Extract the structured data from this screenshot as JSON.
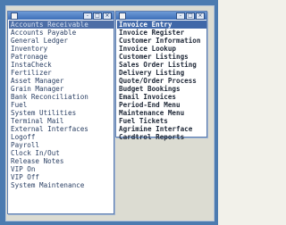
{
  "left_window": {
    "items": [
      {
        "label": "Accounts Receivable",
        "selected": true
      },
      {
        "label": "Accounts Payable"
      },
      {
        "label": "General Ledger"
      },
      {
        "label": "Inventory"
      },
      {
        "label": "Patronage"
      },
      {
        "label": "InstaCheck"
      },
      {
        "label": "Fertilizer"
      },
      {
        "label": "Asset Manager"
      },
      {
        "label": "Grain Manager"
      },
      {
        "label": "Bank Reconciliation"
      },
      {
        "label": "Fuel"
      },
      {
        "label": "System Utilities"
      },
      {
        "label": "Terminal Mail"
      },
      {
        "label": "External Interfaces"
      },
      {
        "label": "Logoff"
      },
      {
        "label": "Payroll"
      },
      {
        "label": "Clock In/Out"
      },
      {
        "label": "Release Notes"
      },
      {
        "label": "VIP On"
      },
      {
        "label": "VIP Off"
      },
      {
        "label": "System Maintenance"
      }
    ]
  },
  "right_window": {
    "items": [
      {
        "label": "Invoice Entry",
        "selected": true
      },
      {
        "label": "Invoice Register"
      },
      {
        "label": "Customer Information"
      },
      {
        "label": "Invoice Lookup"
      },
      {
        "label": "Customer Listings"
      },
      {
        "label": "Sales Order Listing"
      },
      {
        "label": "Delivery Listing"
      },
      {
        "label": "Quote/Order Process"
      },
      {
        "label": "Budget Bookings"
      },
      {
        "label": "Email Invoices"
      },
      {
        "label": "Period-End Menu"
      },
      {
        "label": "Maintenance Menu"
      },
      {
        "label": "Fuel Tickets"
      },
      {
        "label": "Agrimine Interface"
      },
      {
        "label": "Cardtrol Reports"
      }
    ]
  },
  "titlebar_buttons": [
    "-",
    "□",
    "×"
  ],
  "titlebar_icon": "window-icon"
}
